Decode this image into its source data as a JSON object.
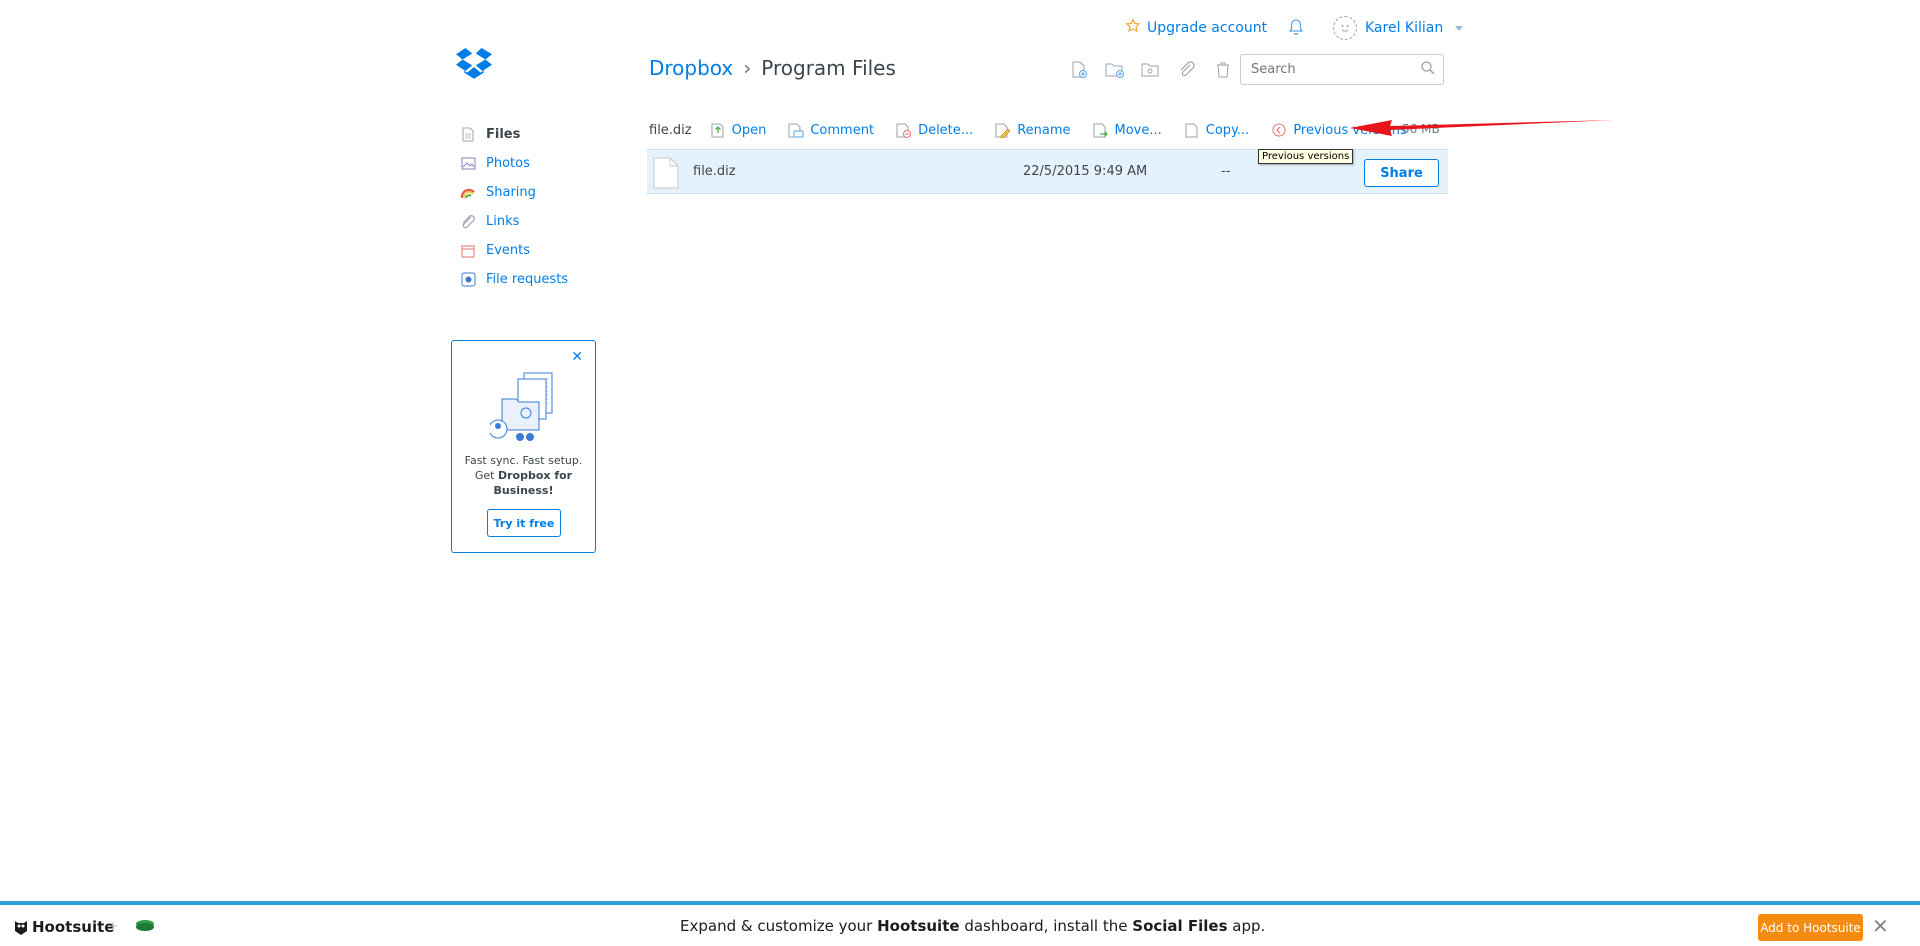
{
  "topbar": {
    "upgrade_label": "Upgrade account",
    "user_name": "Karel Kilian"
  },
  "breadcrumb": {
    "root": "Dropbox",
    "separator": "›",
    "current": "Program Files"
  },
  "search": {
    "placeholder": "Search"
  },
  "sidebar": {
    "items": [
      {
        "label": "Files",
        "icon": "file-icon"
      },
      {
        "label": "Photos",
        "icon": "photo-icon"
      },
      {
        "label": "Sharing",
        "icon": "sharing-icon"
      },
      {
        "label": "Links",
        "icon": "link-icon"
      },
      {
        "label": "Events",
        "icon": "calendar-icon"
      },
      {
        "label": "File requests",
        "icon": "file-request-icon"
      }
    ]
  },
  "promo": {
    "line1": "Fast sync. Fast setup.",
    "line2_prefix": "Get ",
    "line2_bold": "Dropbox for Business!",
    "button": "Try it free"
  },
  "actionbar": {
    "selected_file": "file.diz",
    "actions": [
      "Open",
      "Comment",
      "Delete...",
      "Rename",
      "Move...",
      "Copy...",
      "Previous versions"
    ],
    "size_partial": "56 MB"
  },
  "file_row": {
    "name": "file.diz",
    "modified": "22/5/2015 9:49 AM",
    "size": "--",
    "share_label": "Share"
  },
  "tooltip": "Previous versions",
  "banner": {
    "brand": "Hootsuite",
    "message_1": "Expand & customize your ",
    "message_bold_1": "Hootsuite",
    "message_2": " dashboard, install the ",
    "message_bold_2": "Social Files",
    "message_3": " app.",
    "add_button": "Add to Hootsuite",
    "close": "✕"
  },
  "colors": {
    "accent": "#007ee5",
    "row_highlight": "#e5f1fb",
    "banner_button": "#f58c11",
    "annotation_arrow": "#e8141c"
  }
}
